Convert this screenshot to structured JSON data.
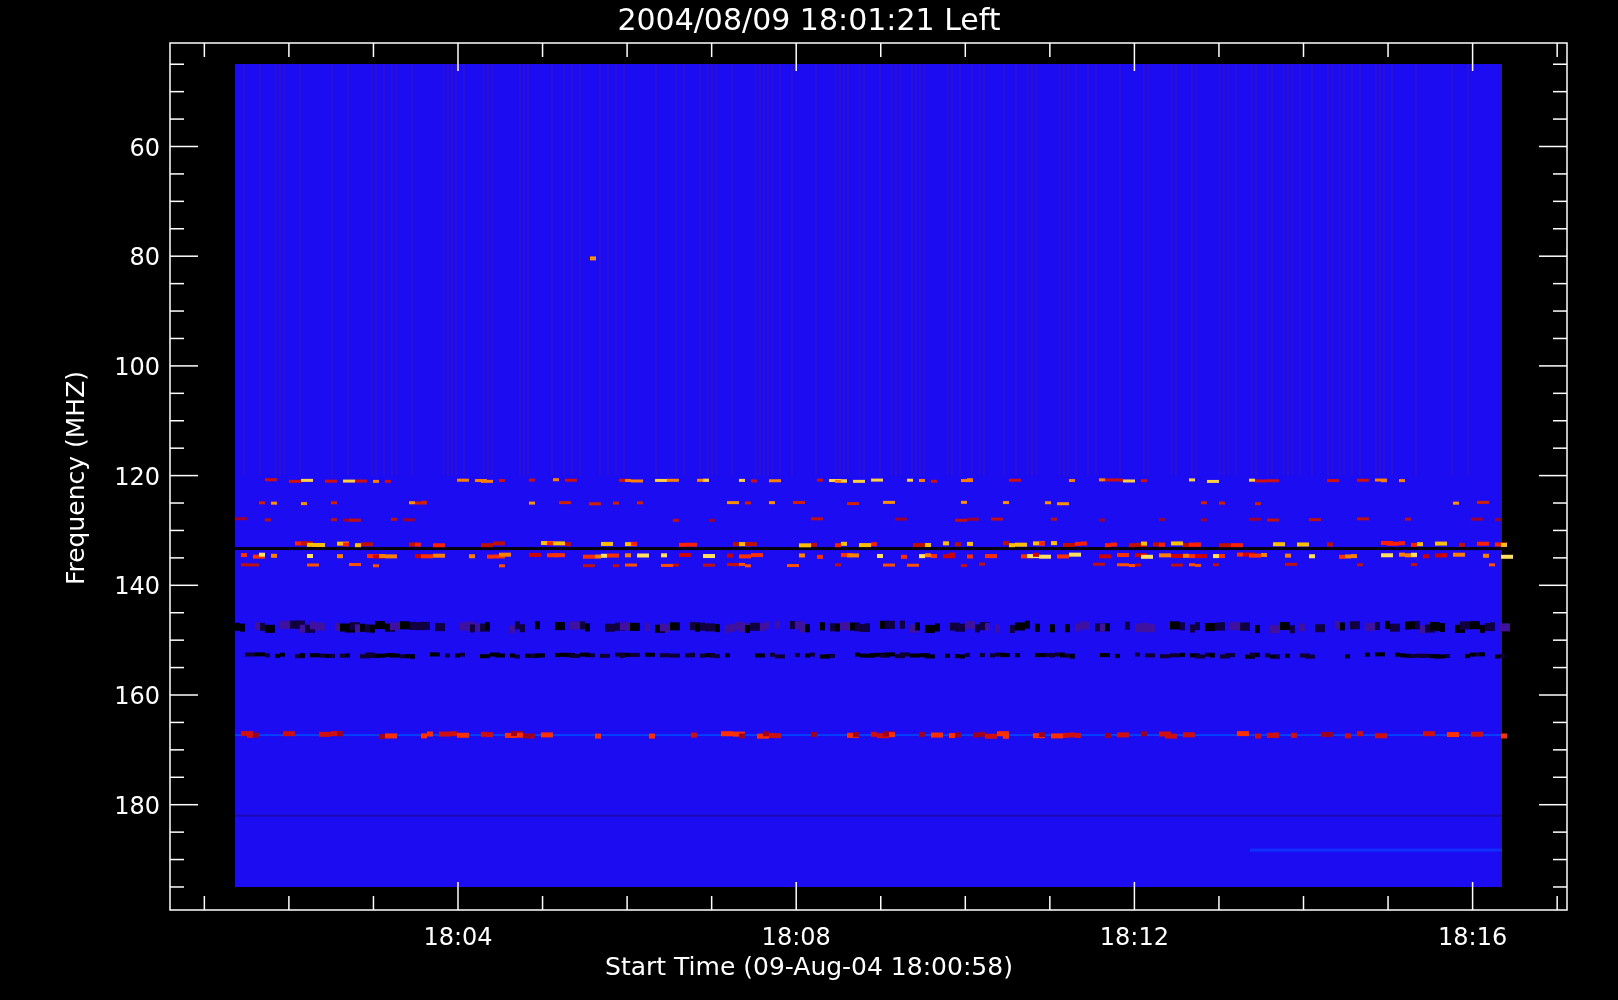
{
  "title": "2004/08/09 18:01:21 Left",
  "x_axis": {
    "label": "Start Time (09-Aug-04 18:00:58)",
    "ticks": [
      "18:04",
      "18:08",
      "18:12",
      "18:16"
    ]
  },
  "y_axis": {
    "label": "Frequency (MHZ)",
    "ticks": [
      "60",
      "80",
      "100",
      "120",
      "140",
      "160",
      "180"
    ]
  }
}
